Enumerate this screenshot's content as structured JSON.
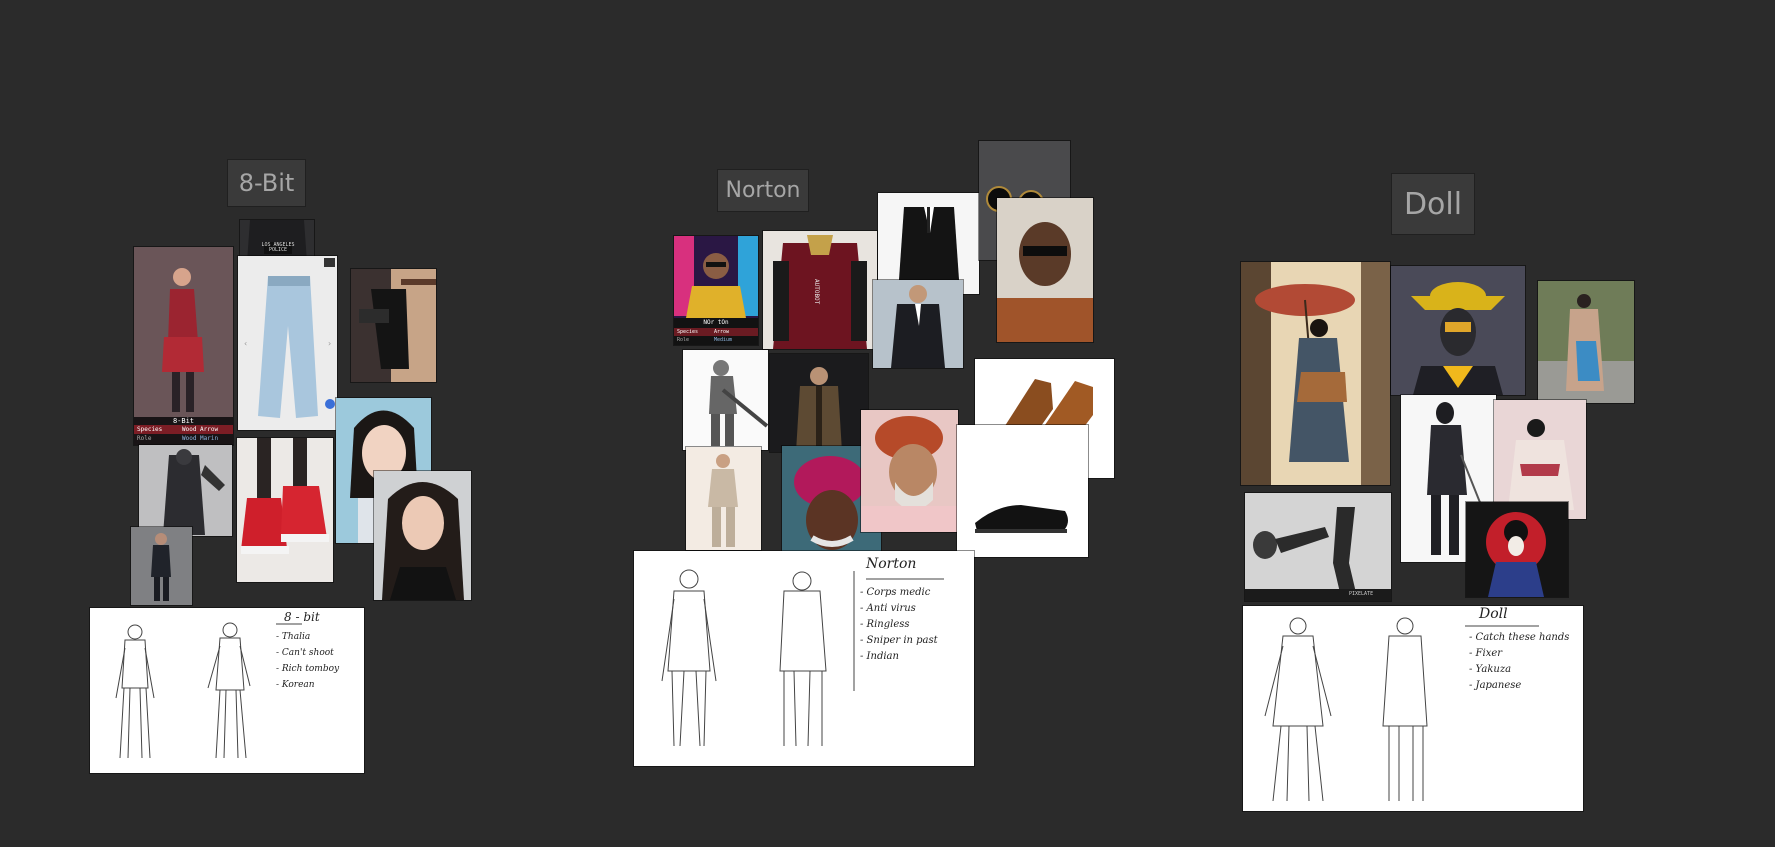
{
  "boards": [
    {
      "id": "8bit",
      "title": "8-Bit"
    },
    {
      "id": "norton",
      "title": "Norton"
    },
    {
      "id": "doll",
      "title": "Doll"
    }
  ],
  "eightbit": {
    "badge": "8-Bit",
    "species_label": "Species",
    "species_value": "Wood Arrow",
    "role_label": "Role",
    "role_value": "Wood Marin",
    "police_text": "LOS ANGELES POLICE",
    "note_title": "8 - bit",
    "notes": [
      "- Thalia",
      "- Can't shoot",
      "- Rich tomboy",
      "- Korean"
    ]
  },
  "norton": {
    "badge": "NOr tOn",
    "species_label": "Species",
    "species_value": "Arrow",
    "role_label": "Role",
    "role_value": "Medium",
    "jacket_text": "AUTOBOT",
    "note_title": "Norton",
    "notes": [
      "- Corps medic",
      "- Anti virus",
      "- Ringless",
      "- Sniper in past",
      "- Indian"
    ]
  },
  "doll": {
    "note_title": "Doll",
    "notes": [
      "- Catch these hands",
      "- Fixer",
      "- Yakuza",
      "- Japanese"
    ],
    "caption": "PIXELATE"
  },
  "colors": {
    "background": "#2b2b2b",
    "label_bg": "#3a3a3a",
    "label_text": "#a6a6a6",
    "accent_red": "#c21f2a"
  }
}
